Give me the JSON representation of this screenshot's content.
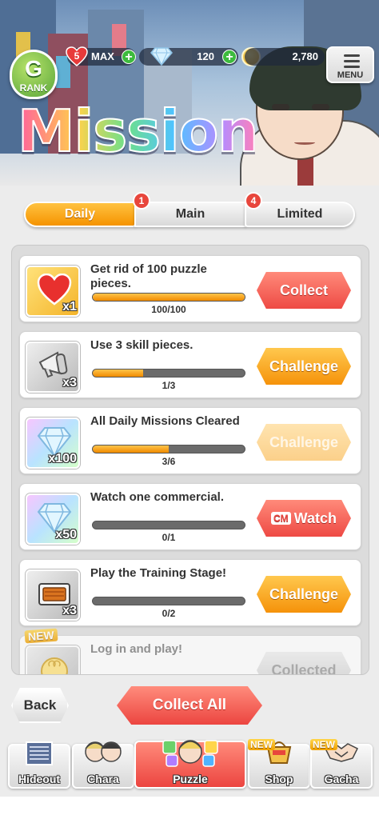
{
  "header": {
    "rank_letter": "G",
    "rank_label": "RANK",
    "title": "Mission",
    "stamina_level": "5",
    "stamina_value": "MAX",
    "gems": "120",
    "coins": "2,780",
    "menu_label": "MENU"
  },
  "tabs": [
    {
      "label": "Daily",
      "badge": "1",
      "active": true
    },
    {
      "label": "Main",
      "badge": "4",
      "active": false
    },
    {
      "label": "Limited",
      "badge": "",
      "active": false
    }
  ],
  "missions": [
    {
      "text": "Get rid of 100 puzzle pieces.",
      "reward_qty": "x1",
      "reward_icon": "heart-icon",
      "progress": "100/100",
      "progress_fraction": 1.0,
      "action": "Collect",
      "action_state": "collect"
    },
    {
      "text": "Use 3 skill pieces.",
      "reward_qty": "x3",
      "reward_icon": "megaphone-icon",
      "progress": "1/3",
      "progress_fraction": 0.33,
      "action": "Challenge",
      "action_state": "challenge"
    },
    {
      "text": "All Daily Missions Cleared",
      "reward_qty": "x100",
      "reward_icon": "diamond-icon",
      "progress": "3/6",
      "progress_fraction": 0.5,
      "action": "Challenge",
      "action_state": "disabled"
    },
    {
      "text": "Watch one commercial.",
      "reward_qty": "x50",
      "reward_icon": "diamond-icon",
      "progress": "0/1",
      "progress_fraction": 0.0,
      "action_tag": "CM",
      "action": "Watch",
      "action_state": "watch"
    },
    {
      "text": "Play the Training Stage!",
      "reward_qty": "x3",
      "reward_icon": "food-tray-icon",
      "progress": "0/2",
      "progress_fraction": 0.0,
      "action": "Challenge",
      "action_state": "challenge"
    },
    {
      "text": "Log in and play!",
      "new_tag": "NEW",
      "reward_icon": "clover-coin-icon",
      "action": "Collected",
      "action_state": "collected"
    }
  ],
  "buttons": {
    "back": "Back",
    "collect_all": "Collect All"
  },
  "nav": [
    {
      "label": "Hideout",
      "icon": "building-icon",
      "new": ""
    },
    {
      "label": "Chara",
      "icon": "characters-icon",
      "new": ""
    },
    {
      "label": "Puzzle",
      "icon": "puzzle-icon",
      "new": "",
      "active": true
    },
    {
      "label": "Shop",
      "icon": "shop-basket-icon",
      "new": "NEW"
    },
    {
      "label": "Gacha",
      "icon": "handshake-icon",
      "new": "NEW"
    }
  ],
  "colors": {
    "accent_orange": "#f59300",
    "accent_red": "#ec4540",
    "progress_fill": "#f08a00"
  }
}
